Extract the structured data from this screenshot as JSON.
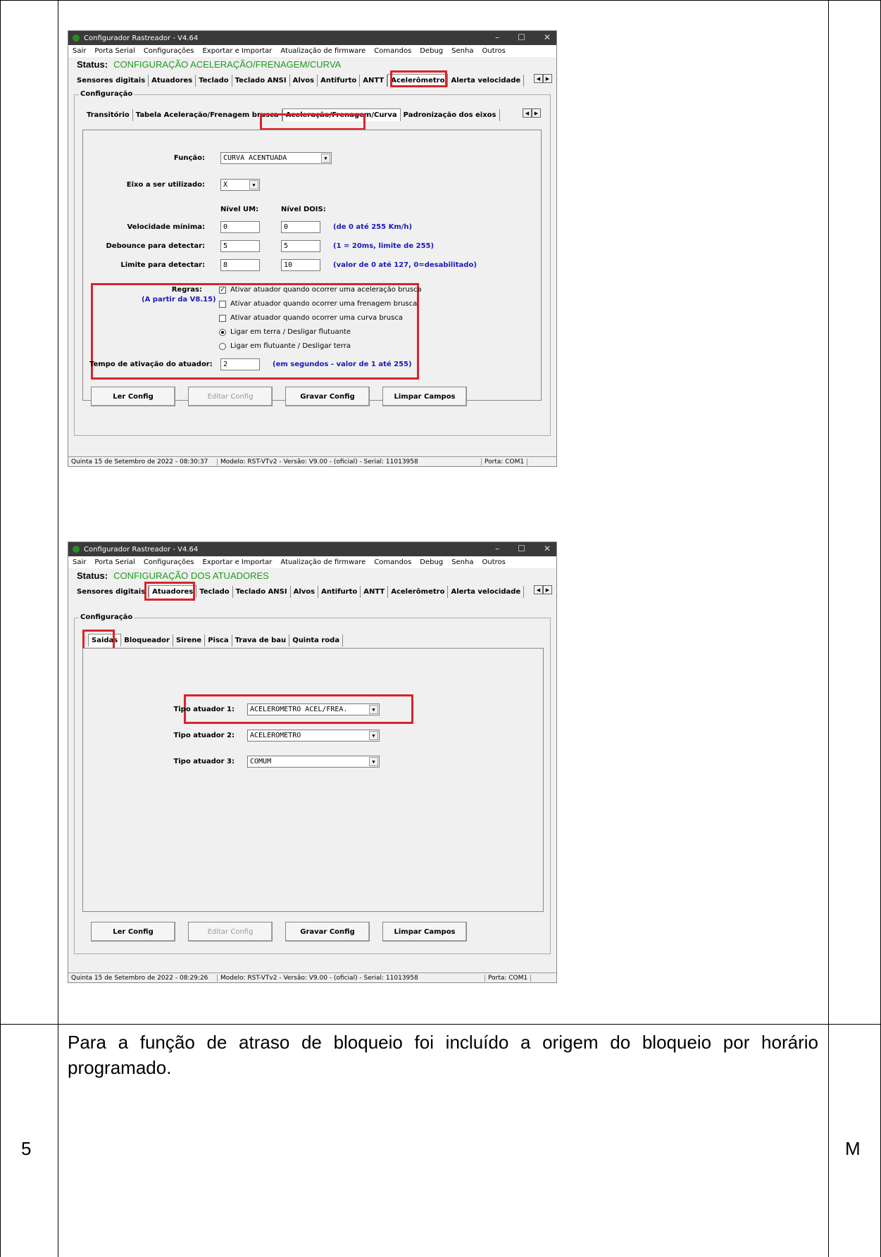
{
  "doc": {
    "row_number": "5",
    "row_mark": "M",
    "paragraph": "Para a função de atraso de bloqueio foi incluído a origem do bloqueio por horário programado."
  },
  "win1": {
    "title": "Configurador Rastreador - V4.64",
    "menu": [
      "Sair",
      "Porta Serial",
      "Configurações",
      "Exportar e Importar",
      "Atualização de firmware",
      "Comandos",
      "Debug",
      "Senha",
      "Outros"
    ],
    "status_label": "Status:",
    "status_value": "CONFIGURAÇÃO ACELERAÇÃO/FRENAGEM/CURVA",
    "tabs": [
      "Sensores digitais",
      "Atuadores",
      "Teclado",
      "Teclado ANSI",
      "Alvos",
      "Antifurto",
      "ANTT",
      "Acelerômetro",
      "Alerta velocidade"
    ],
    "group_title": "Configuração",
    "subtabs": [
      "Transitório",
      "Tabela Aceleração/Frenagem brusca",
      "Aceleração/Frenagem/Curva",
      "Padronização dos eixos"
    ],
    "funcao_label": "Função:",
    "funcao_value": "CURVA ACENTUADA",
    "eixo_label": "Eixo a ser utilizado:",
    "eixo_value": "X",
    "nivel_um": "Nível UM:",
    "nivel_dois": "Nível DOIS:",
    "vel_label": "Velocidade mínima:",
    "vel_um": "0",
    "vel_dois": "0",
    "vel_hint": "(de 0 até 255 Km/h)",
    "deb_label": "Debounce para detectar:",
    "deb_um": "5",
    "deb_dois": "5",
    "deb_hint": "(1 = 20ms, limite de 255)",
    "lim_label": "Limite para detectar:",
    "lim_um": "8",
    "lim_dois": "10",
    "lim_hint": "(valor de 0 até 127, 0=desabilitado)",
    "regras_label": "Regras:",
    "regras_sub": "(A partir da V8.15)",
    "opt1": "Ativar atuador quando ocorrer uma aceleração brusca",
    "opt2": "Ativar atuador quando ocorrer uma frenagem brusca",
    "opt3": "Ativar atuador quando ocorrer uma curva brusca",
    "opt4": "Ligar em terra / Desligar flutuante",
    "opt5": "Ligar em flutuante / Desligar terra",
    "tempo_label": "Tempo de ativação do atuador:",
    "tempo_value": "2",
    "tempo_hint": "(em segundos - valor de 1 até 255)",
    "btn_ler": "Ler Config",
    "btn_editar": "Editar Config",
    "btn_gravar": "Gravar Config",
    "btn_limpar": "Limpar Campos",
    "sb_date": "Quinta 15 de Setembro de 2022  -  08:30:37",
    "sb_model": "Modelo: RST-VTv2  -  Versão: V9.00 - (oficial)  -  Serial: 11013958",
    "sb_port": "Porta: COM1"
  },
  "win2": {
    "title": "Configurador Rastreador - V4.64",
    "menu": [
      "Sair",
      "Porta Serial",
      "Configurações",
      "Exportar e Importar",
      "Atualização de firmware",
      "Comandos",
      "Debug",
      "Senha",
      "Outros"
    ],
    "status_label": "Status:",
    "status_value": "CONFIGURAÇÃO DOS ATUADORES",
    "tabs": [
      "Sensores digitais",
      "Atuadores",
      "Teclado",
      "Teclado ANSI",
      "Alvos",
      "Antifurto",
      "ANTT",
      "Acelerômetro",
      "Alerta velocidade"
    ],
    "group_title": "Configuração",
    "subtabs": [
      "Saidas",
      "Bloqueador",
      "Sirene",
      "Pisca",
      "Trava de bau",
      "Quinta roda"
    ],
    "t1_label": "Tipo atuador 1:",
    "t1_value": "ACELEROMETRO ACEL/FREA.",
    "t2_label": "Tipo atuador 2:",
    "t2_value": "ACELEROMETRO",
    "t3_label": "Tipo atuador 3:",
    "t3_value": "COMUM",
    "btn_ler": "Ler Config",
    "btn_editar": "Editar Config",
    "btn_gravar": "Gravar Config",
    "btn_limpar": "Limpar Campos",
    "sb_date": "Quinta 15 de Setembro de 2022  -  08:29:26",
    "sb_model": "Modelo: RST-VTv2  -  Versão: V9.00 - (oficial)  -  Serial: 11013958",
    "sb_port": "Porta: COM1"
  }
}
